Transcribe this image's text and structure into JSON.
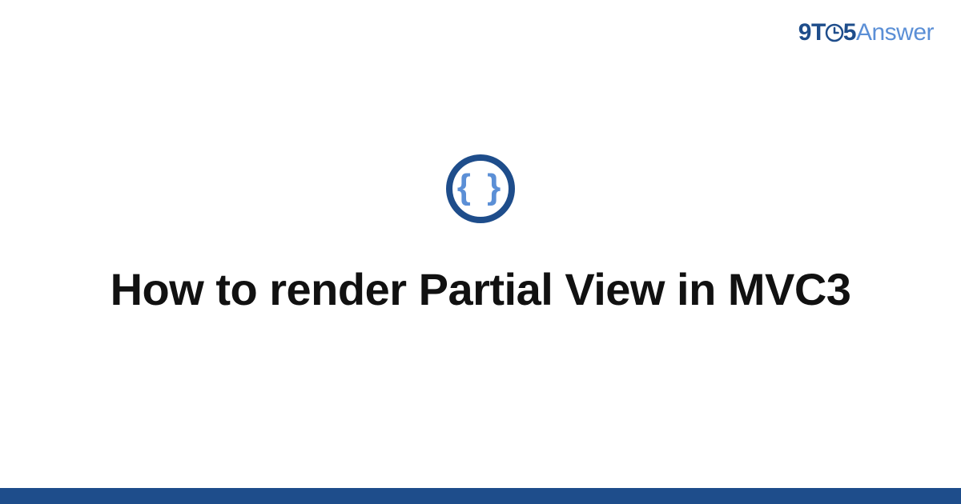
{
  "logo": {
    "nine": "9",
    "t": "T",
    "five": "5",
    "answer": "Answer"
  },
  "icon": {
    "braces": "{ }"
  },
  "title": "How to render Partial View in MVC3"
}
